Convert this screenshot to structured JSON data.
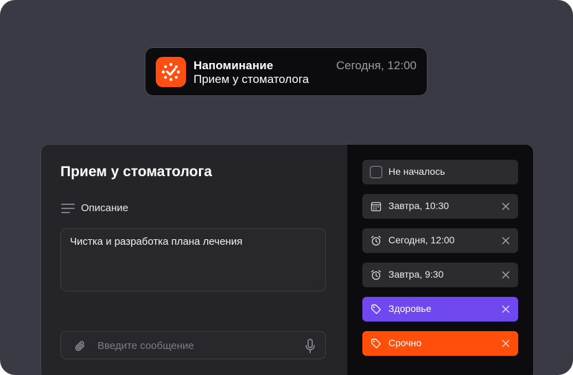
{
  "notification": {
    "title": "Напоминание",
    "body": "Прием у стоматолога",
    "time": "Сегодня, 12:00",
    "icon": "app-logo-icon"
  },
  "task": {
    "title": "Прием у стоматолога",
    "description_label": "Описание",
    "description_text": "Чистка и разработка плана лечения",
    "message_placeholder": "Введите сообщение"
  },
  "sidebar": {
    "status": {
      "label": "Не началось",
      "checked": false
    },
    "due_date": {
      "label": "Завтра, 10:30",
      "icon": "calendar-icon"
    },
    "reminders": [
      {
        "label": "Сегодня, 12:00",
        "icon": "alarm-clock-icon"
      },
      {
        "label": "Завтра, 9:30",
        "icon": "alarm-clock-icon"
      }
    ],
    "tags": [
      {
        "label": "Здоровье",
        "icon": "tag-icon",
        "color": "#6f48f0"
      },
      {
        "label": "Срочно",
        "icon": "tag-icon",
        "color": "#ff4f0b"
      }
    ]
  },
  "colors": {
    "accent_orange": "#ff4f12",
    "tag_purple": "#6f48f0",
    "tag_orange": "#ff4f0b",
    "background": "#3a3a44"
  }
}
